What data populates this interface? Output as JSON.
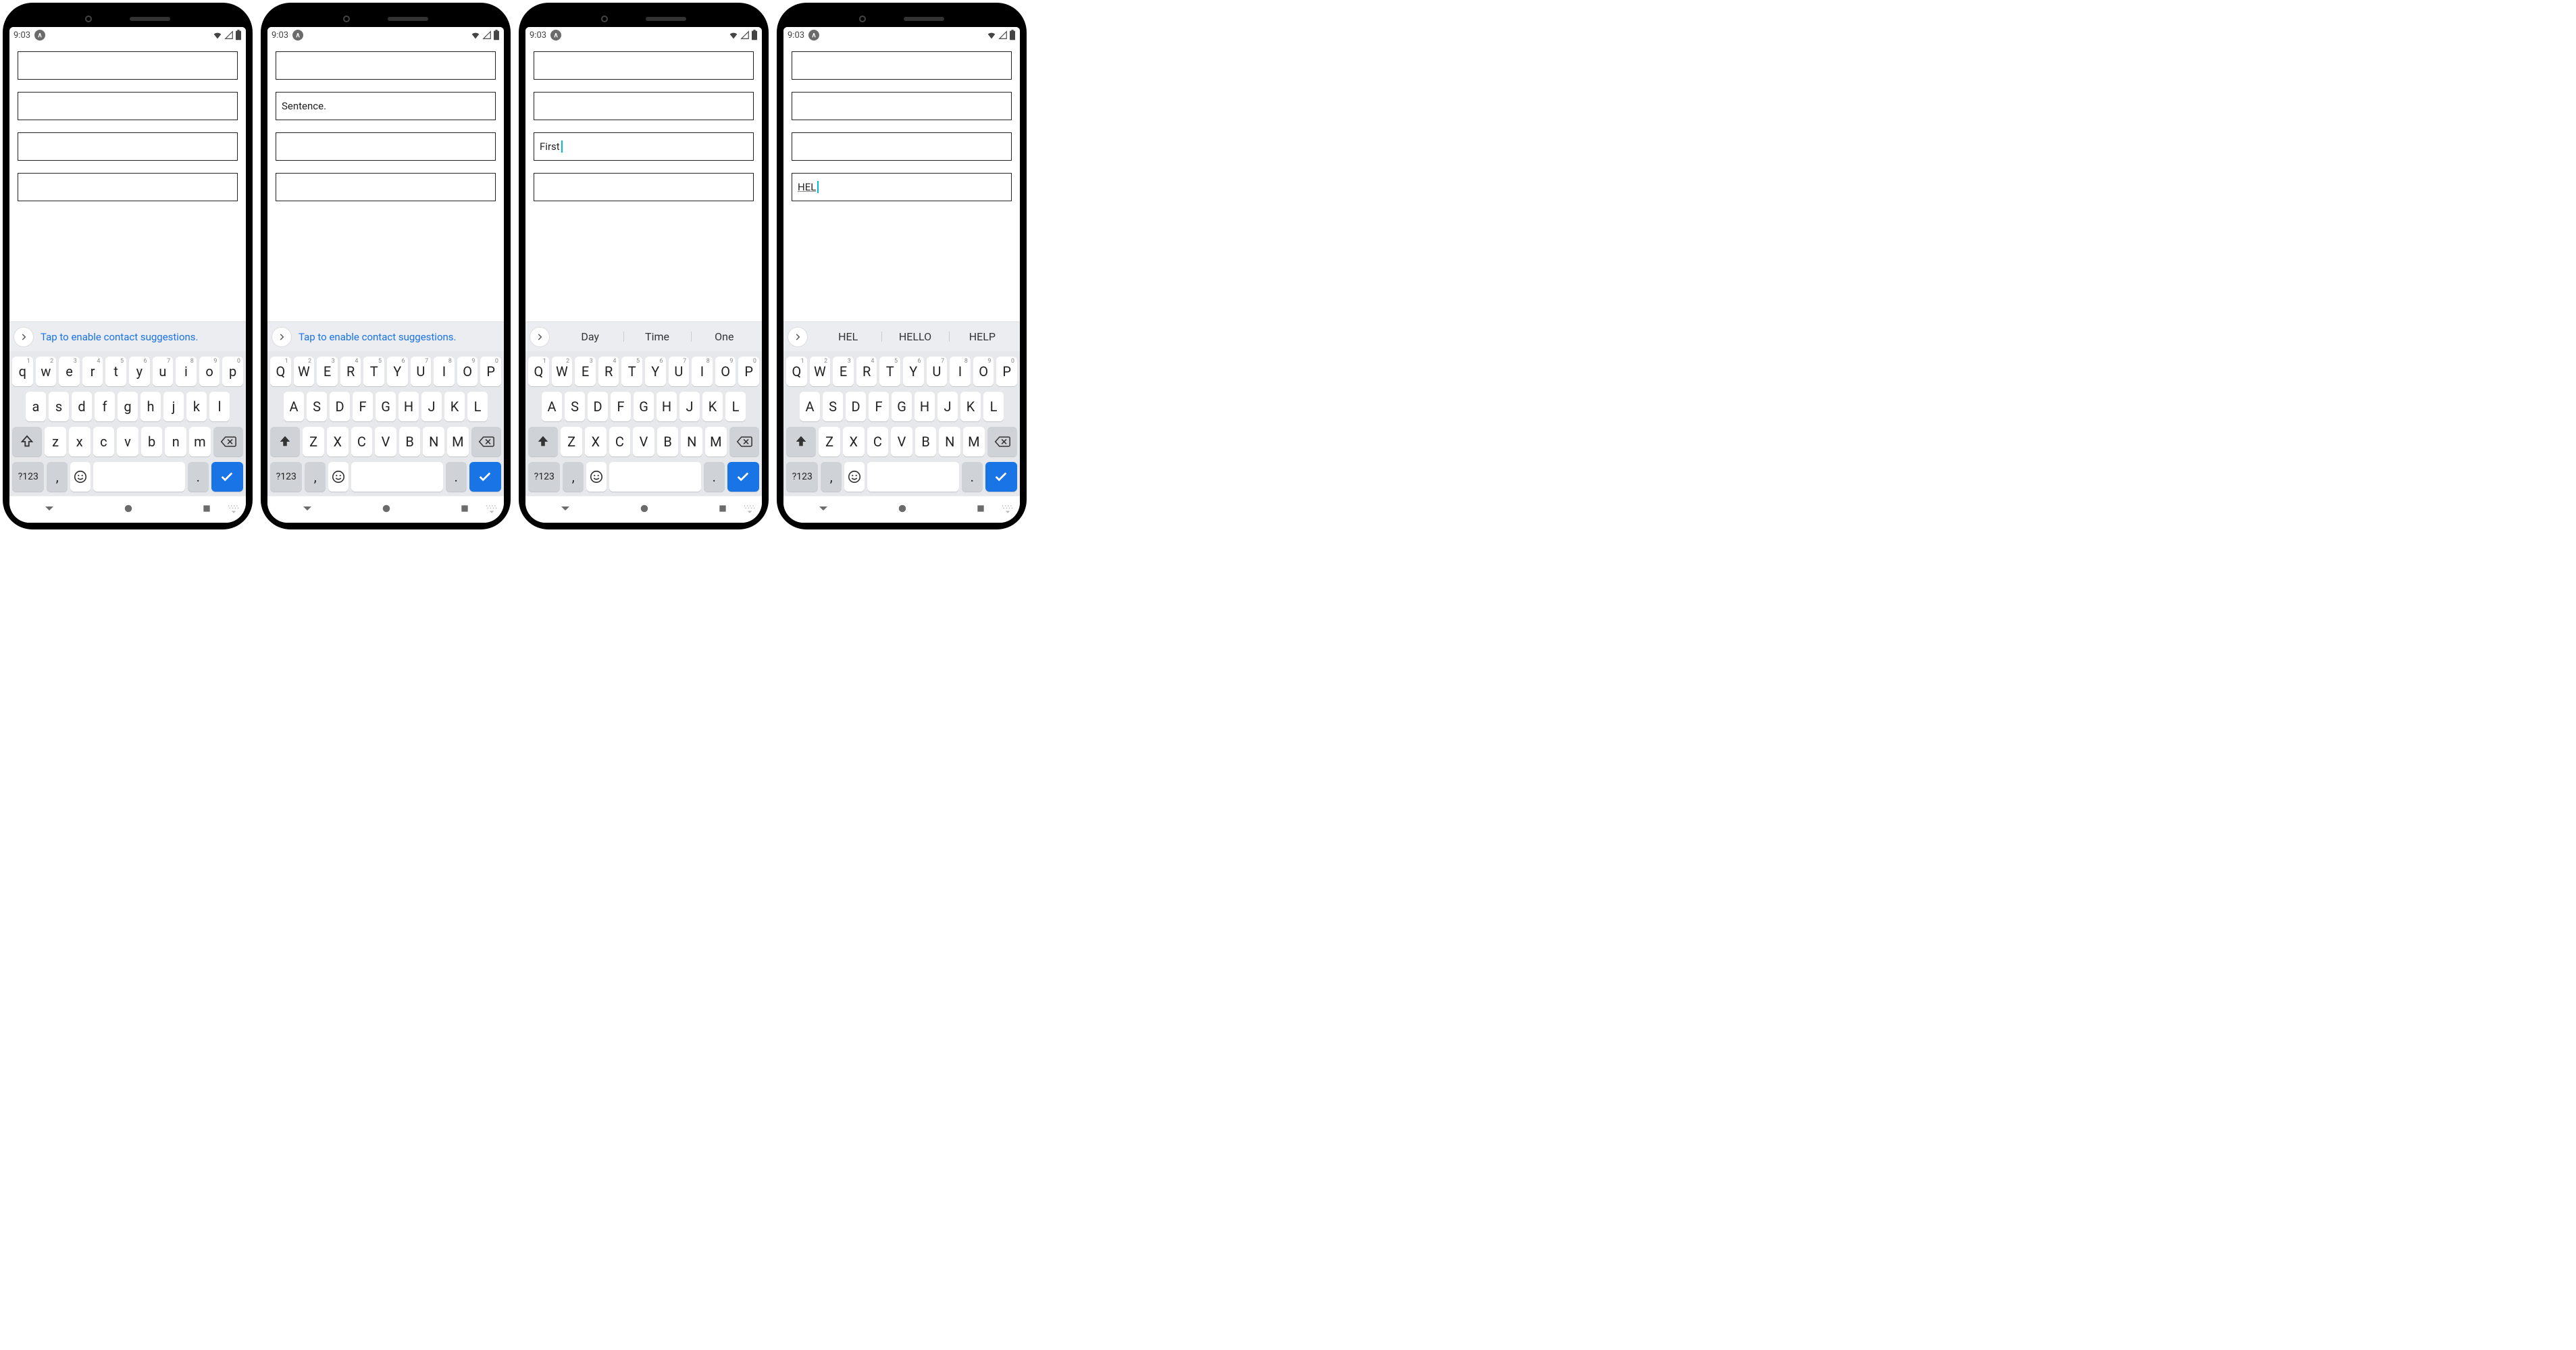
{
  "status": {
    "time": "9:03"
  },
  "suggest_hint": "Tap to enable contact suggestions.",
  "keys_lower": {
    "row1": [
      "q",
      "w",
      "e",
      "r",
      "t",
      "y",
      "u",
      "i",
      "o",
      "p"
    ],
    "row2": [
      "a",
      "s",
      "d",
      "f",
      "g",
      "h",
      "j",
      "k",
      "l"
    ],
    "row3": [
      "z",
      "x",
      "c",
      "v",
      "b",
      "n",
      "m"
    ],
    "hints": [
      "1",
      "2",
      "3",
      "4",
      "5",
      "6",
      "7",
      "8",
      "9",
      "0"
    ]
  },
  "keys_upper": {
    "row1": [
      "Q",
      "W",
      "E",
      "R",
      "T",
      "Y",
      "U",
      "I",
      "O",
      "P"
    ],
    "row2": [
      "A",
      "S",
      "D",
      "F",
      "G",
      "H",
      "J",
      "K",
      "L"
    ],
    "row3": [
      "Z",
      "X",
      "C",
      "V",
      "B",
      "N",
      "M"
    ],
    "hints": [
      "1",
      "2",
      "3",
      "4",
      "5",
      "6",
      "7",
      "8",
      "9",
      "0"
    ]
  },
  "bottom": {
    "sym": "?123",
    "comma": ",",
    "period": "."
  },
  "screens": [
    {
      "fields": [
        "",
        "",
        "",
        ""
      ],
      "caret_field": -1,
      "underline_fields": [],
      "kb_case": "lower",
      "shift_active": false,
      "suggest_mode": "hint",
      "suggestions": []
    },
    {
      "fields": [
        "",
        "Sentence.",
        "",
        ""
      ],
      "caret_field": -1,
      "underline_fields": [],
      "kb_case": "upper",
      "shift_active": true,
      "suggest_mode": "hint",
      "suggestions": []
    },
    {
      "fields": [
        "",
        "",
        "First",
        ""
      ],
      "caret_field": 2,
      "underline_fields": [],
      "kb_case": "upper",
      "shift_active": true,
      "suggest_mode": "words",
      "suggestions": [
        "Day",
        "Time",
        "One"
      ]
    },
    {
      "fields": [
        "",
        "",
        "",
        "HEL"
      ],
      "caret_field": 3,
      "underline_fields": [
        3
      ],
      "kb_case": "upper",
      "shift_active": true,
      "suggest_mode": "words",
      "suggestions": [
        "HEL",
        "HELLO",
        "HELP"
      ]
    }
  ]
}
